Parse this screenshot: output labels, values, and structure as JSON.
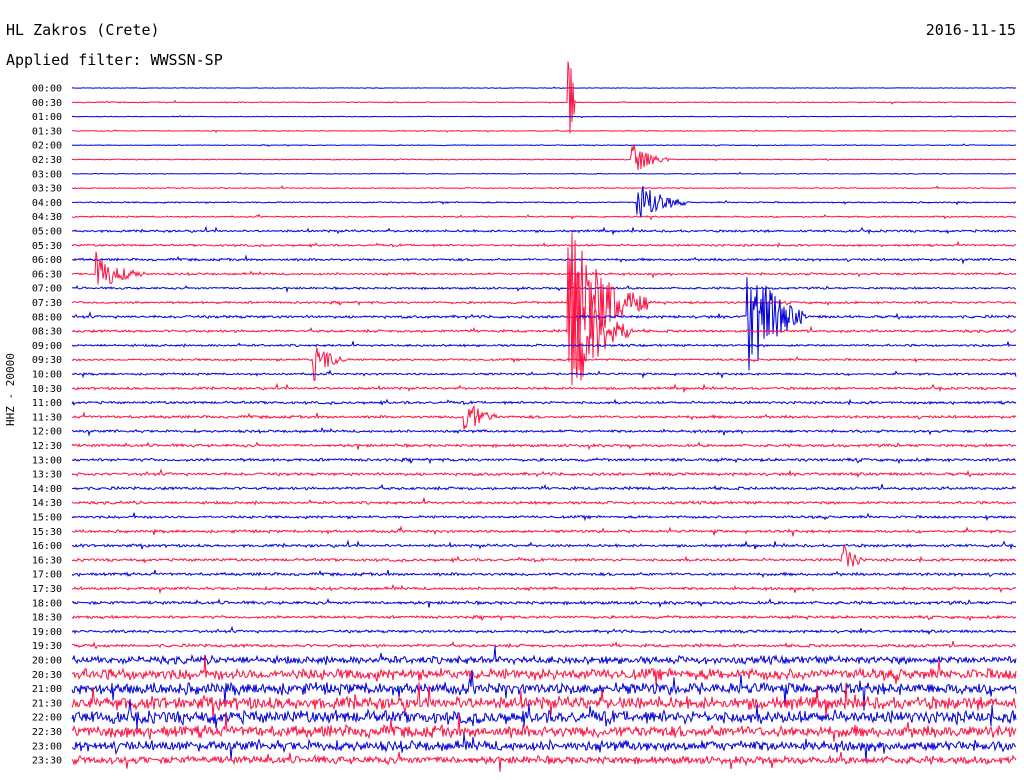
{
  "header": {
    "station": "HL Zakros (Crete)",
    "date": "2016-11-15",
    "filter_label": "Applied filter:",
    "filter_value": "WWSSN-SP",
    "channel": "HHZ - 20000"
  },
  "colors": {
    "trace_a": "#0000dd",
    "trace_b": "#ff1040"
  },
  "chart_data": {
    "type": "line",
    "title": "HL Zakros (Crete)",
    "subtitle": "Applied filter: WWSSN-SP",
    "ylabel": "HHZ - 20000",
    "date": "2016-11-15",
    "x_unit": "minutes within 30-min row",
    "xlim": [
      0,
      30
    ],
    "row_labels": [
      "00:00",
      "00:30",
      "01:00",
      "01:30",
      "02:00",
      "02:30",
      "03:00",
      "03:30",
      "04:00",
      "04:30",
      "05:00",
      "05:30",
      "06:00",
      "06:30",
      "07:00",
      "07:30",
      "08:00",
      "08:30",
      "09:00",
      "09:30",
      "10:00",
      "10:30",
      "11:00",
      "11:30",
      "12:00",
      "12:30",
      "13:00",
      "13:30",
      "14:00",
      "14:30",
      "15:00",
      "15:30",
      "16:00",
      "16:30",
      "17:00",
      "17:30",
      "18:00",
      "18:30",
      "19:00",
      "19:30",
      "20:00",
      "20:30",
      "21:00",
      "21:30",
      "22:00",
      "22:30",
      "23:00",
      "23:30"
    ],
    "noise_level": [
      0.3,
      0.6,
      0.4,
      0.5,
      0.5,
      0.6,
      0.5,
      0.6,
      0.8,
      0.8,
      1.3,
      1.2,
      1.4,
      1.2,
      1.2,
      1.3,
      1.6,
      1.5,
      1.3,
      1.2,
      1.2,
      1.4,
      1.5,
      1.6,
      1.5,
      1.6,
      1.7,
      1.7,
      1.7,
      1.6,
      1.5,
      1.6,
      1.6,
      1.6,
      1.7,
      1.6,
      1.8,
      1.6,
      1.6,
      1.8,
      4.5,
      6.5,
      7.0,
      7.5,
      7.5,
      7.0,
      6.0,
      4.5
    ],
    "events": [
      {
        "row": 1,
        "minute": 15.8,
        "amplitude": 8,
        "duration": 0.2,
        "label": ""
      },
      {
        "row": 5,
        "minute": 17.8,
        "amplitude": 2.5,
        "duration": 1.2,
        "label": ""
      },
      {
        "row": 8,
        "minute": 18.0,
        "amplitude": 3.5,
        "duration": 1.5,
        "label": ""
      },
      {
        "row": 13,
        "minute": 0.8,
        "amplitude": 3,
        "duration": 1.5,
        "label": ""
      },
      {
        "row": 15,
        "minute": 15.8,
        "amplitude": 12,
        "duration": 2.5,
        "label": ""
      },
      {
        "row": 16,
        "minute": 21.5,
        "amplitude": 10,
        "duration": 1.8,
        "label": ""
      },
      {
        "row": 17,
        "minute": 15.8,
        "amplitude": 12,
        "duration": 2.0,
        "label": ""
      },
      {
        "row": 19,
        "minute": 7.7,
        "amplitude": 3,
        "duration": 1.0,
        "label": ""
      },
      {
        "row": 23,
        "minute": 12.5,
        "amplitude": 3,
        "duration": 1.0,
        "label": ""
      },
      {
        "row": 33,
        "minute": 24.5,
        "amplitude": 3,
        "duration": 0.6,
        "label": ""
      }
    ]
  }
}
